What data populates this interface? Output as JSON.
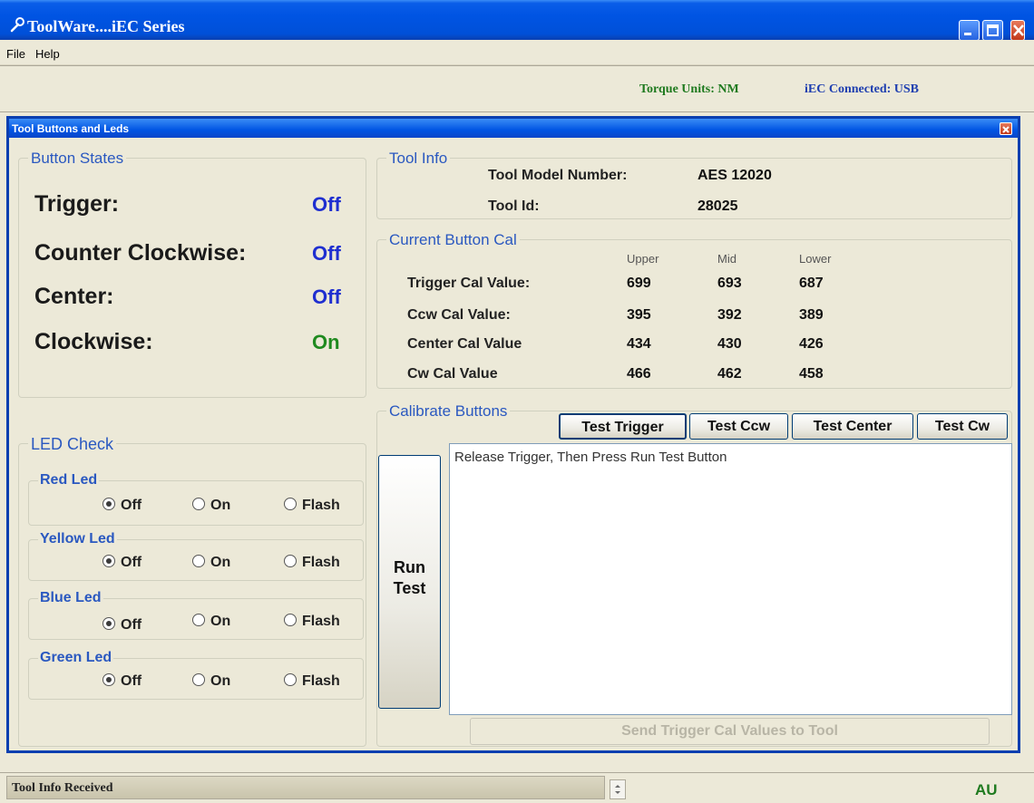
{
  "app": {
    "title": "ToolWare....iEC Series"
  },
  "menu": {
    "file": "File",
    "help": "Help"
  },
  "status": {
    "torque_units": "Torque Units: NM",
    "connection": "iEC Connected: USB"
  },
  "child": {
    "title": "Tool Buttons and Leds"
  },
  "button_states": {
    "legend": "Button States",
    "items": [
      {
        "label": "Trigger:",
        "value": "Off"
      },
      {
        "label": "Counter Clockwise:",
        "value": "Off"
      },
      {
        "label": "Center:",
        "value": "Off"
      },
      {
        "label": "Clockwise:",
        "value": "On"
      }
    ]
  },
  "tool_info": {
    "legend": "Tool Info",
    "model_label": "Tool Model Number:",
    "model_value": "AES 12020",
    "id_label": "Tool Id:",
    "id_value": "28025"
  },
  "cal": {
    "legend": "Current Button Cal",
    "headers": [
      "Upper",
      "Mid",
      "Lower"
    ],
    "rows": [
      {
        "label": "Trigger Cal Value:",
        "upper": "699",
        "mid": "693",
        "lower": "687"
      },
      {
        "label": "Ccw Cal Value:",
        "upper": "395",
        "mid": "392",
        "lower": "389"
      },
      {
        "label": "Center Cal Value",
        "upper": "434",
        "mid": "430",
        "lower": "426"
      },
      {
        "label": "Cw Cal Value",
        "upper": "466",
        "mid": "462",
        "lower": "458"
      }
    ]
  },
  "calibrate": {
    "legend": "Calibrate Buttons",
    "tests": [
      "Test Trigger",
      "Test Ccw",
      "Test Center",
      "Test Cw"
    ],
    "run_line1": "Run",
    "run_line2": "Test",
    "output_text": "Release Trigger, Then Press Run Test Button",
    "send_label": "Send Trigger Cal Values to Tool"
  },
  "led_check": {
    "legend": "LED Check",
    "options": [
      "Off",
      "On",
      "Flash"
    ],
    "leds": [
      {
        "name": "Red Led",
        "selected": "Off"
      },
      {
        "name": "Yellow Led",
        "selected": "Off"
      },
      {
        "name": "Blue Led",
        "selected": "Off"
      },
      {
        "name": "Green Led",
        "selected": "Off"
      }
    ]
  },
  "bottom": {
    "status_text": "Tool Info Received",
    "locale": "AU"
  },
  "colors": {
    "off": "#1f2fd0",
    "on": "#1f8a1f",
    "legend": "#2a58c0"
  }
}
